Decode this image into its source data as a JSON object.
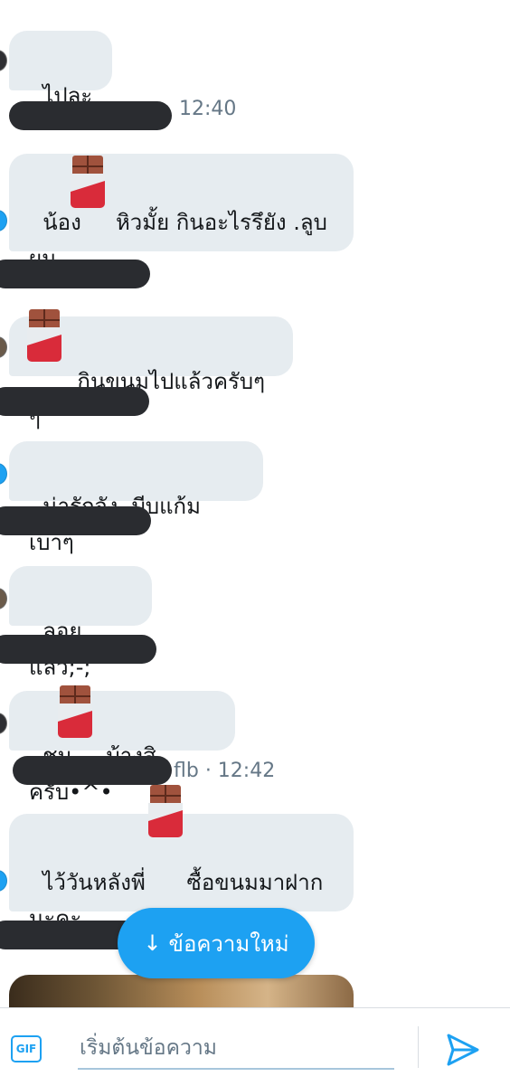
{
  "messages": [
    {
      "text": "ไปละ"
    },
    {
      "text": "น้อง     หิวมั้ย กินอะไรรึยัง .ลูบ\nผม"
    },
    {
      "text": "     กินขนมไปแล้วครับๆๆ"
    },
    {
      "text": "น่ารักจัง .บีบแก้มเบาๆ"
    },
    {
      "text": "ลอยแล้ว;-;"
    },
    {
      "text": "ชม     บ้างสิครับ•^•"
    },
    {
      "text": "ไว้วันหลังพี่      ซื้อขนมมาฝาก\nนะคะ"
    }
  ],
  "timestamps": {
    "first": "12:40",
    "second": "flb · 12:42"
  },
  "new_messages_button": {
    "arrow": "↓",
    "label": "ข้อความใหม่"
  },
  "composer": {
    "gif_label": "GIF",
    "placeholder": "เริ่มต้นข้อความ",
    "send_icon": "send-icon"
  },
  "colors": {
    "accent": "#1da1f2",
    "bubble": "#e6ecf0",
    "timestamp": "#657786",
    "redaction": "#2a2c30"
  }
}
